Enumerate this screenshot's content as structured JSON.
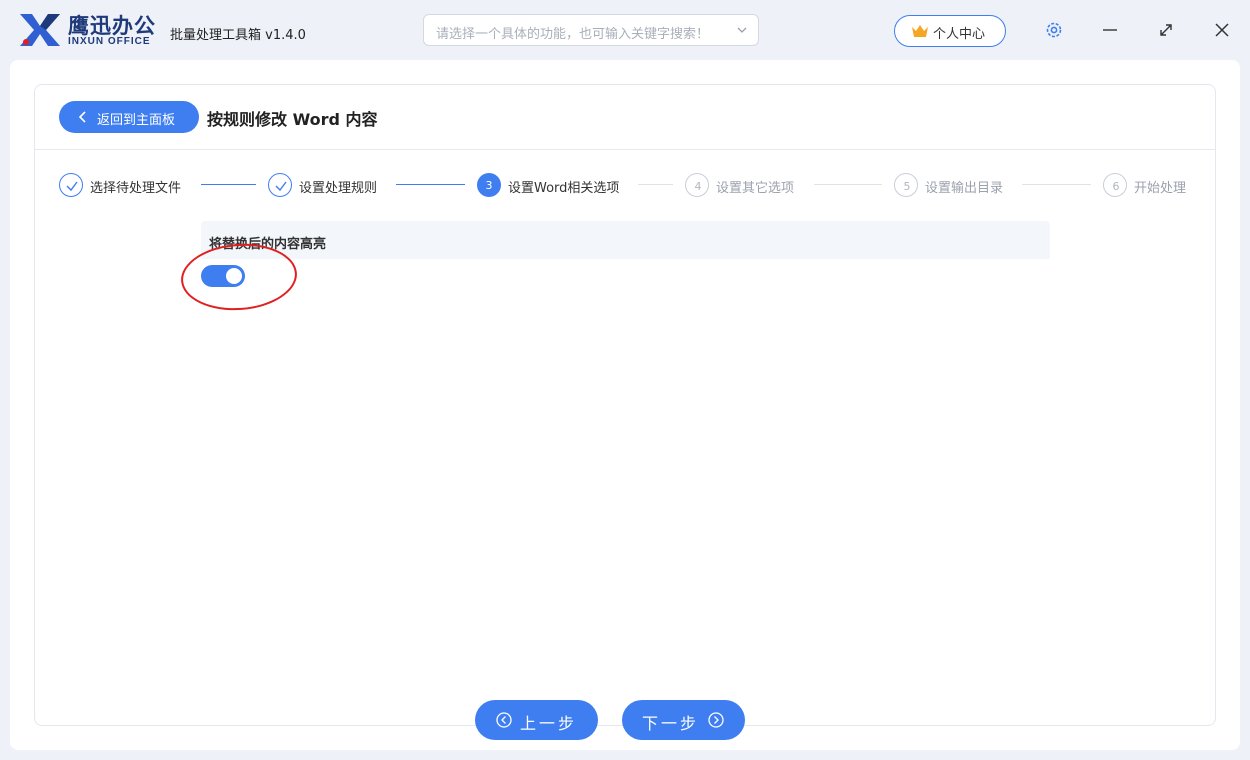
{
  "titlebar": {
    "brand_cn": "鹰迅办公",
    "brand_en": "INXUN OFFICE",
    "app_title": "批量处理工具箱 v1.4.0",
    "search_placeholder": "请选择一个具体的功能，也可输入关键字搜索！",
    "user_center_label": "个人中心",
    "accent_color": "#3f7ef0"
  },
  "header": {
    "back_label": "返回到主面板",
    "page_title": "按规则修改 Word 内容"
  },
  "steps": [
    {
      "num": "1",
      "label": "选择待处理文件",
      "state": "done"
    },
    {
      "num": "2",
      "label": "设置处理规则",
      "state": "done"
    },
    {
      "num": "3",
      "label": "设置Word相关选项",
      "state": "active"
    },
    {
      "num": "4",
      "label": "设置其它选项",
      "state": "pending"
    },
    {
      "num": "5",
      "label": "设置输出目录",
      "state": "pending"
    },
    {
      "num": "6",
      "label": "开始处理",
      "state": "pending"
    }
  ],
  "option": {
    "label": "将替换后的内容高亮",
    "enabled": true
  },
  "nav": {
    "prev_label": "上一步",
    "next_label": "下一步"
  }
}
